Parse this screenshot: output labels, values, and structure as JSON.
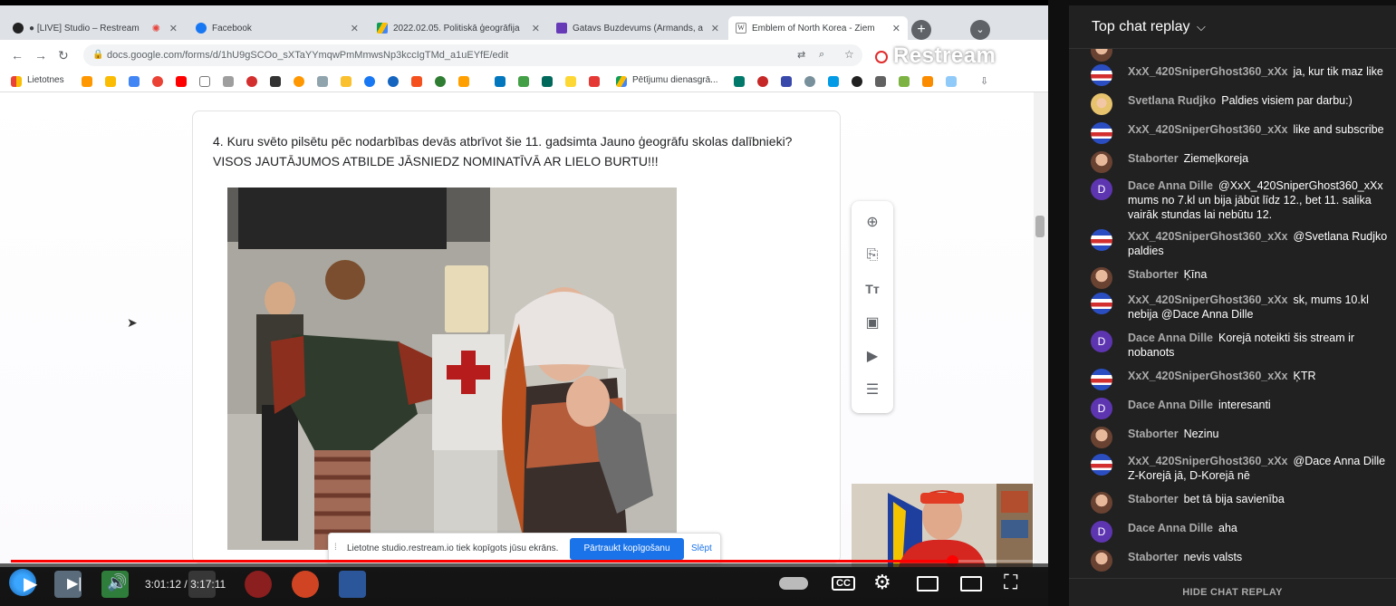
{
  "browser": {
    "tabs": [
      {
        "title": "● [LIVE] Studio – Restream",
        "favicon_color": "#222222",
        "active": false
      },
      {
        "title": "Facebook",
        "favicon_color": "#1877f2",
        "active": false
      },
      {
        "title": "2022.02.05. Politiskā ģeogrāfija",
        "favicon_color": "#fbbc04",
        "active": false
      },
      {
        "title": "Gatavs Buzdevums (Armands, a",
        "favicon_color": "#673ab7",
        "active": false
      },
      {
        "title": "Emblem of North Korea - Ziem",
        "favicon_color": "#555555",
        "active": true
      }
    ],
    "new_tab_label": "+",
    "url": "docs.google.com/forms/d/1hU9gSCOo_sXTaYYmqwPmMmwsNp3kccIgTMd_a1uEYfE/edit",
    "restream_logo": "Restream",
    "bookmarks": {
      "first_label": "Lietotnes",
      "research_label": "Pētījumu dienasgrā..."
    }
  },
  "form": {
    "question_text": "4. Kuru svēto pilsētu pēc nodarbības devās atbrīvot šie 11. gadsimta Jauno ģeogrāfu skolas dalībnieki? VISOS JAUTĀJUMOS ATBILDE JĀSNIEDZ NOMINATĪVĀ AR LIELO BURTU!!!",
    "side_tools": [
      "add-icon",
      "import-icon",
      "title-icon",
      "image-icon",
      "video-icon",
      "section-icon"
    ]
  },
  "sharebar": {
    "text": "Lietotne studio.restream.io tiek kopīgots jūsu ekrāns.",
    "stop_label": "Pārtraukt kopīgošanu",
    "hide_label": "Slēpt"
  },
  "player": {
    "current_time": "3:01:12",
    "separator": " / ",
    "duration": "3:17:11",
    "progress_fraction": 0.917,
    "accent": "#ff0000"
  },
  "chat": {
    "title": "Top chat replay",
    "footer": "HIDE CHAT REPLAY",
    "messages": [
      {
        "author": "XxX_420SniperGhost360_xXx",
        "text": "ja, kur tik maz like",
        "avatar": "flag"
      },
      {
        "author": "Svetlana Rudjko",
        "text": "Paldies visiem par darbu:)",
        "avatar": "sv"
      },
      {
        "author": "XxX_420SniperGhost360_xXx",
        "text": "like and subscribe",
        "avatar": "flag"
      },
      {
        "author": "Staborter",
        "text": "Ziemeļkoreja",
        "avatar": "s"
      },
      {
        "author": "Dace Anna Dille",
        "text": "@XxX_420SniperGhost360_xXx mums no 7.kl un bija jābūt līdz 12., bet 11. salika vairāk stundas lai nebūtu 12.",
        "avatar": "d"
      },
      {
        "author": "XxX_420SniperGhost360_xXx",
        "text": "@Svetlana Rudjko paldies",
        "avatar": "flag"
      },
      {
        "author": "Staborter",
        "text": "Ķīna",
        "avatar": "s"
      },
      {
        "author": "XxX_420SniperGhost360_xXx",
        "text": "sk, mums 10.kl nebija @Dace Anna Dille",
        "avatar": "flag"
      },
      {
        "author": "Dace Anna Dille",
        "text": "Korejā noteikti šis stream ir nobanots",
        "avatar": "d"
      },
      {
        "author": "XxX_420SniperGhost360_xXx",
        "text": "ĶTR",
        "avatar": "flag"
      },
      {
        "author": "Dace Anna Dille",
        "text": "interesanti",
        "avatar": "d"
      },
      {
        "author": "Staborter",
        "text": "Nezinu",
        "avatar": "s"
      },
      {
        "author": "XxX_420SniperGhost360_xXx",
        "text": "@Dace Anna Dille Z-Korejā jā, D-Korejā nē",
        "avatar": "flag"
      },
      {
        "author": "Staborter",
        "text": "bet tā bija savienība",
        "avatar": "s"
      },
      {
        "author": "Dace Anna Dille",
        "text": "aha",
        "avatar": "d"
      },
      {
        "author": "Staborter",
        "text": "nevis valsts",
        "avatar": "s"
      }
    ]
  }
}
